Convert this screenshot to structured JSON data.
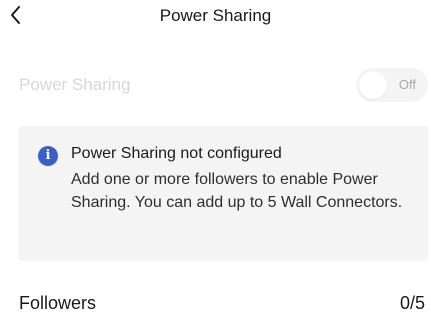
{
  "header": {
    "title": "Power Sharing",
    "back_icon": "chevron-left-icon"
  },
  "power_sharing_toggle": {
    "label": "Power Sharing",
    "state": "Off",
    "enabled": false
  },
  "info_card": {
    "icon": "info-icon",
    "icon_glyph": "i",
    "icon_color": "#3b5fc8",
    "title": "Power Sharing not configured",
    "body": "Add one or more followers to enable Power Sharing. You can add up to 5 Wall Connectors."
  },
  "followers": {
    "label": "Followers",
    "count": "0/5"
  }
}
